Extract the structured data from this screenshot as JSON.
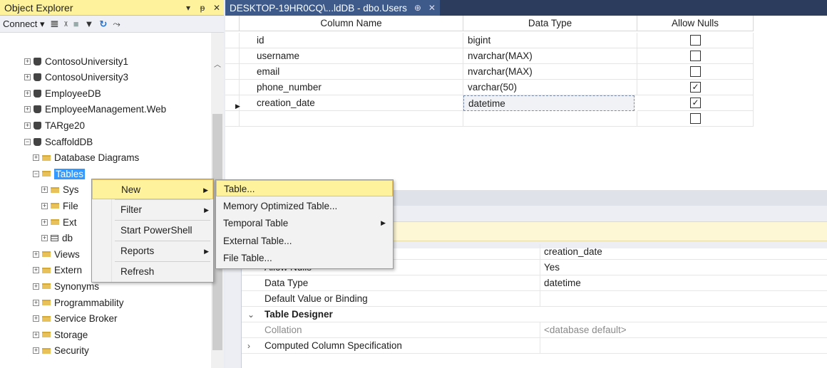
{
  "object_explorer": {
    "title": "Object Explorer",
    "pin_glyph": "▾ ᵽ",
    "close_glyph": "✕",
    "toolbar": {
      "connect_label": "Connect ▾",
      "icons": [
        "connect-plug-icon",
        "disconnect-plug-icon",
        "stop-icon",
        "filter-icon",
        "refresh-icon",
        "activity-monitor-icon"
      ]
    },
    "tree": [
      {
        "label": "ContosoUniversity1",
        "type": "db",
        "level": 0
      },
      {
        "label": "ContosoUniversity3",
        "type": "db",
        "level": 0
      },
      {
        "label": "EmployeeDB",
        "type": "db",
        "level": 0
      },
      {
        "label": "EmployeeManagement.Web",
        "type": "db",
        "level": 0
      },
      {
        "label": "TARge20",
        "type": "db",
        "level": 0
      },
      {
        "label": "ScaffoldDB",
        "type": "db",
        "level": 0,
        "expanded": true
      },
      {
        "label": "Database Diagrams",
        "type": "folder",
        "level": 1
      },
      {
        "label": "Tables",
        "type": "folder",
        "level": 1,
        "expanded": true,
        "selected": true
      },
      {
        "label": "Sys",
        "type": "folder",
        "level": 2
      },
      {
        "label": "File",
        "type": "folder",
        "level": 2
      },
      {
        "label": "Ext",
        "type": "folder",
        "level": 2
      },
      {
        "label": "db",
        "type": "table",
        "level": 2
      },
      {
        "label": "Views",
        "type": "folder",
        "level": 1
      },
      {
        "label": "Extern",
        "type": "folder",
        "level": 1
      },
      {
        "label": "Synonyms",
        "type": "folder",
        "level": 1
      },
      {
        "label": "Programmability",
        "type": "folder",
        "level": 1
      },
      {
        "label": "Service Broker",
        "type": "folder",
        "level": 1
      },
      {
        "label": "Storage",
        "type": "folder",
        "level": 1
      },
      {
        "label": "Security",
        "type": "folder",
        "level": 1
      }
    ]
  },
  "document": {
    "tab_label": "DESKTOP-19HR0CQ\\...ldDB - dbo.Users",
    "tab_pin": "⊕",
    "tab_close": "✕",
    "columns_header": {
      "name": "Column Name",
      "type": "Data Type",
      "nulls": "Allow Nulls"
    },
    "rows": [
      {
        "name": "id",
        "type": "bigint",
        "allow_nulls": false
      },
      {
        "name": "username",
        "type": "nvarchar(MAX)",
        "allow_nulls": false
      },
      {
        "name": "email",
        "type": "nvarchar(MAX)",
        "allow_nulls": false
      },
      {
        "name": "phone_number",
        "type": "varchar(50)",
        "allow_nulls": true
      },
      {
        "name": "creation_date",
        "type": "datetime",
        "allow_nulls": true,
        "current": true
      },
      {
        "name": "",
        "type": "",
        "allow_nulls": false
      }
    ],
    "properties": [
      {
        "name": "",
        "value": "creation_date"
      },
      {
        "name": "Allow Nulls",
        "value": "Yes"
      },
      {
        "name": "Data Type",
        "value": "datetime"
      },
      {
        "name": "Default Value or Binding",
        "value": ""
      },
      {
        "name": "Table Designer",
        "value": "",
        "category": true,
        "expander": "⌄"
      },
      {
        "name": "Collation",
        "value": "<database default>",
        "gray": true
      },
      {
        "name": "Computed Column Specification",
        "value": "",
        "expander": "›"
      }
    ]
  },
  "context_menu": {
    "items": [
      {
        "label": "New",
        "submenu": true,
        "highlighted": true
      },
      {
        "label": "Filter",
        "submenu": true
      },
      {
        "label": "Start PowerShell"
      },
      {
        "label": "Reports",
        "submenu": true
      },
      {
        "label": "Refresh"
      }
    ]
  },
  "submenu_new": {
    "items": [
      {
        "label": "Table...",
        "highlighted": true
      },
      {
        "label": "Memory Optimized Table..."
      },
      {
        "label": "Temporal Table",
        "submenu": true
      },
      {
        "label": "External Table..."
      },
      {
        "label": "File Table..."
      }
    ]
  },
  "colors": {
    "accent_yellow": "#fff29d",
    "tab_bar": "#2b3c5c",
    "selection_blue": "#3399ff"
  }
}
